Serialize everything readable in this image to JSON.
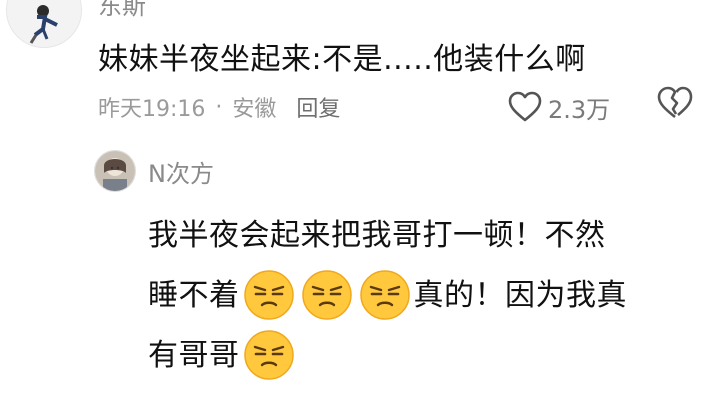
{
  "top_comment": {
    "username": "东斯",
    "text": "妹妹半夜坐起来:不是.....他装什么啊",
    "time": "昨天19:16",
    "separator": "·",
    "location": "安徽",
    "reply_label": "回复",
    "like_count": "2.3万"
  },
  "reply": {
    "username": "N次方",
    "line1": "我半夜会起来把我哥打一顿！不然",
    "line2_prefix": "睡不着",
    "line2_suffix": "真的！因为我真",
    "line3_prefix": "有哥哥",
    "emoji": "annoyed-face-emoji"
  },
  "colors": {
    "text": "#111111",
    "muted": "#9a9a9a",
    "emoji_fill": "#ffc83d"
  },
  "icons": [
    "heart-icon",
    "broken-heart-icon",
    "annoyed-face-emoji"
  ]
}
